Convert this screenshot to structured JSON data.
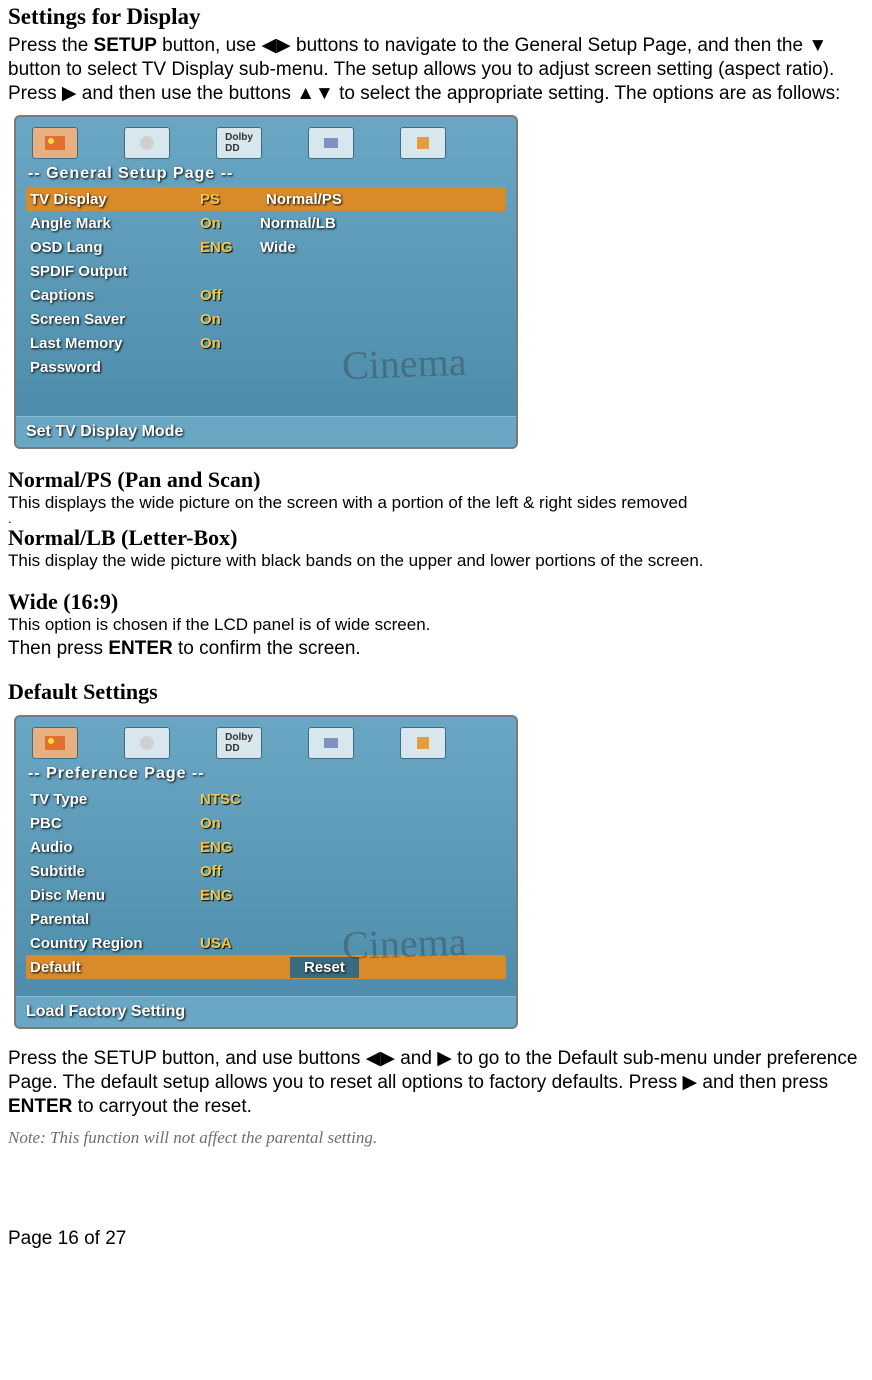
{
  "heading": "Settings for Display",
  "intro": {
    "pre": "Press the ",
    "setup": "SETUP",
    "mid1": " button, use ",
    "arrows_lr": "◀▶",
    "mid2": " buttons to navigate to the General Setup Page, and then the ",
    "arrow_down": "▼",
    "mid3": " button to select TV Display sub-menu. The setup allows you to adjust screen setting (aspect ratio). Press ",
    "arrow_right": "▶",
    "mid4": " and then use the buttons ",
    "arrows_ud": "▲▼",
    "mid5": " to select the appropriate setting. The options are as follows:"
  },
  "screenshot1": {
    "page_title": "-- General Setup Page --",
    "status": "Set TV Display Mode",
    "bg_text": "Cinema",
    "rows": [
      {
        "label": "TV Display",
        "val": "PS",
        "sel": true
      },
      {
        "label": "Angle Mark",
        "val": "On"
      },
      {
        "label": "OSD Lang",
        "val": "ENG"
      },
      {
        "label": "SPDIF Output",
        "val": ""
      },
      {
        "label": "Captions",
        "val": "Off"
      },
      {
        "label": "Screen Saver",
        "val": "On"
      },
      {
        "label": "Last Memory",
        "val": "On"
      },
      {
        "label": "Password",
        "val": ""
      }
    ],
    "options": [
      {
        "label": "Normal/PS",
        "hl": true
      },
      {
        "label": "Normal/LB"
      },
      {
        "label": "Wide"
      }
    ]
  },
  "opt_ps": {
    "title": "Normal/PS (Pan and Scan)",
    "desc": "This displays the wide picture on the screen with a portion of the left & right sides removed"
  },
  "dot": ".",
  "opt_lb": {
    "title": "Normal/LB (Letter-Box)",
    "desc": "This display the wide picture with black bands on the upper and lower portions of the screen."
  },
  "opt_wide": {
    "title": "Wide (16:9)",
    "desc": "This option is chosen if the LCD panel is of wide screen."
  },
  "confirm": {
    "pre": "Then press ",
    "enter": "ENTER",
    "post": " to confirm the screen."
  },
  "default_heading": "Default Settings",
  "screenshot2": {
    "page_title": "-- Preference Page --",
    "status": "Load Factory Setting",
    "bg_text": "Cinema",
    "rows": [
      {
        "label": "TV Type",
        "val": "NTSC"
      },
      {
        "label": "PBC",
        "val": "On"
      },
      {
        "label": "Audio",
        "val": "ENG"
      },
      {
        "label": "Subtitle",
        "val": "Off"
      },
      {
        "label": "Disc Menu",
        "val": "ENG"
      },
      {
        "label": "Parental",
        "val": ""
      },
      {
        "label": "Country Region",
        "val": "USA"
      },
      {
        "label": "Default",
        "val": "",
        "sel": true
      }
    ],
    "options": [
      {
        "label": "Reset",
        "hl": false
      }
    ]
  },
  "default_para": {
    "pre": "Press the SETUP button, and use buttons ",
    "arrows_lr": "◀▶",
    "mid1": " and ",
    "arrow_right": "▶",
    "mid2": " to go to the Default sub-menu under preference Page. The default setup allows you to reset all options to factory defaults. Press ",
    "arrow_right2": "▶",
    "mid3": " and then press ",
    "enter": "ENTER",
    "mid4": " to carryout the reset."
  },
  "note": "Note: This function will not affect the parental setting.",
  "page_num": "Page 16 of 27"
}
